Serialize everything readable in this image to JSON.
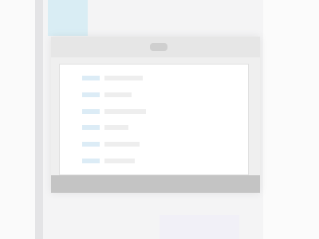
{
  "colors": {
    "background": "#f4f4f5",
    "accent": "#d9edf4",
    "list_highlight": "#dcecf6",
    "statusbar": "#c4c4c4"
  },
  "window": {
    "title": "",
    "list_rows": 6
  }
}
